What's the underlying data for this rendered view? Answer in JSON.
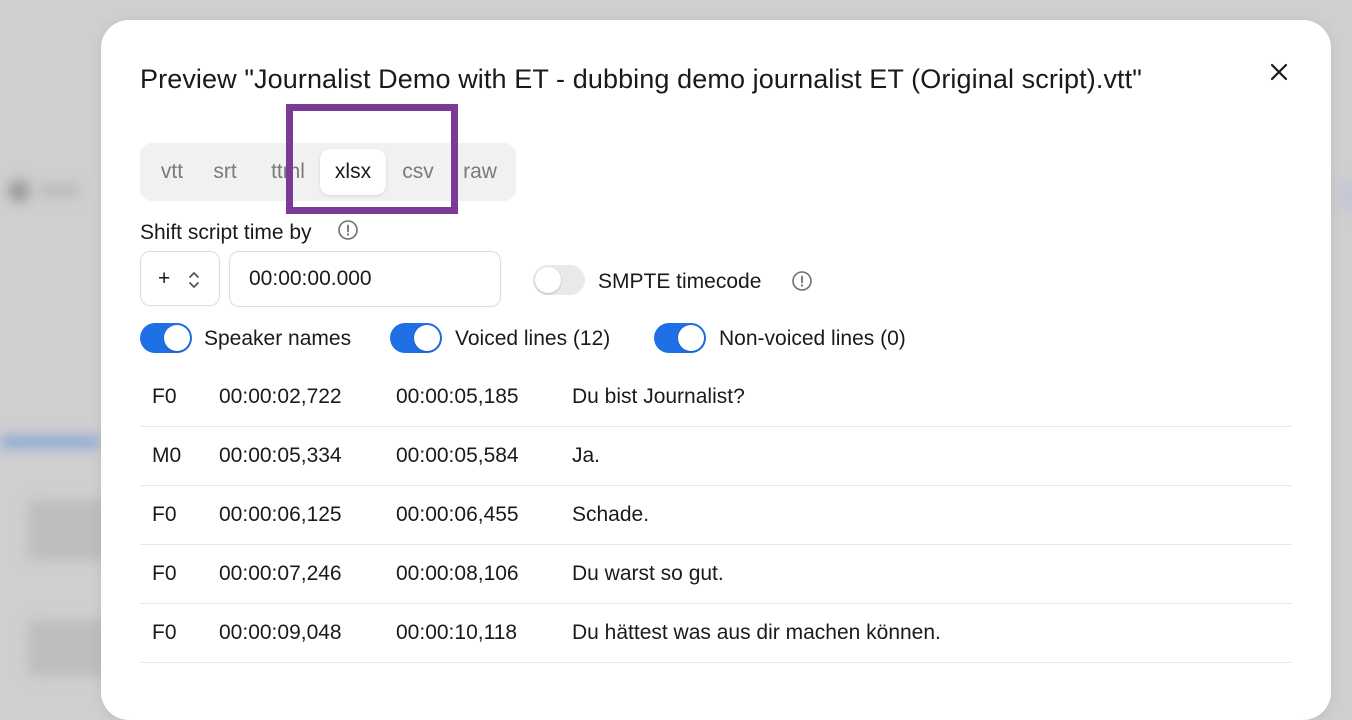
{
  "modal": {
    "title": "Preview \"Journalist Demo with ET - dubbing demo journalist ET (Original script).vtt\""
  },
  "tabs": [
    {
      "label": "vtt"
    },
    {
      "label": "srt"
    },
    {
      "label": "ttml"
    },
    {
      "label": "xlsx",
      "active": true
    },
    {
      "label": "csv"
    },
    {
      "label": "raw"
    }
  ],
  "shift": {
    "label": "Shift script time by",
    "sign": "+",
    "time_value": "00:00:00.000"
  },
  "smpte": {
    "label": "SMPTE timecode",
    "on": false
  },
  "toggles": {
    "speaker_names": {
      "label": "Speaker names",
      "on": true
    },
    "voiced_lines": {
      "label": "Voiced lines (12)",
      "on": true
    },
    "non_voiced_lines": {
      "label": "Non-voiced lines (0)",
      "on": true
    }
  },
  "rows": [
    {
      "speaker": "F0",
      "start": "00:00:02,722",
      "end": "00:00:05,185",
      "text": "Du bist Journalist?"
    },
    {
      "speaker": "M0",
      "start": "00:00:05,334",
      "end": "00:00:05,584",
      "text": "Ja."
    },
    {
      "speaker": "F0",
      "start": "00:00:06,125",
      "end": "00:00:06,455",
      "text": "Schade."
    },
    {
      "speaker": "F0",
      "start": "00:00:07,246",
      "end": "00:00:08,106",
      "text": "Du warst so gut."
    },
    {
      "speaker": "F0",
      "start": "00:00:09,048",
      "end": "00:00:10,118",
      "text": "Du hättest was aus dir machen können."
    }
  ],
  "colors": {
    "accent": "#1f6fe5",
    "highlight": "#7b3a97"
  },
  "icons": {
    "close": "close-icon",
    "info": "info-icon",
    "chevron": "chevron-up-down-icon"
  }
}
